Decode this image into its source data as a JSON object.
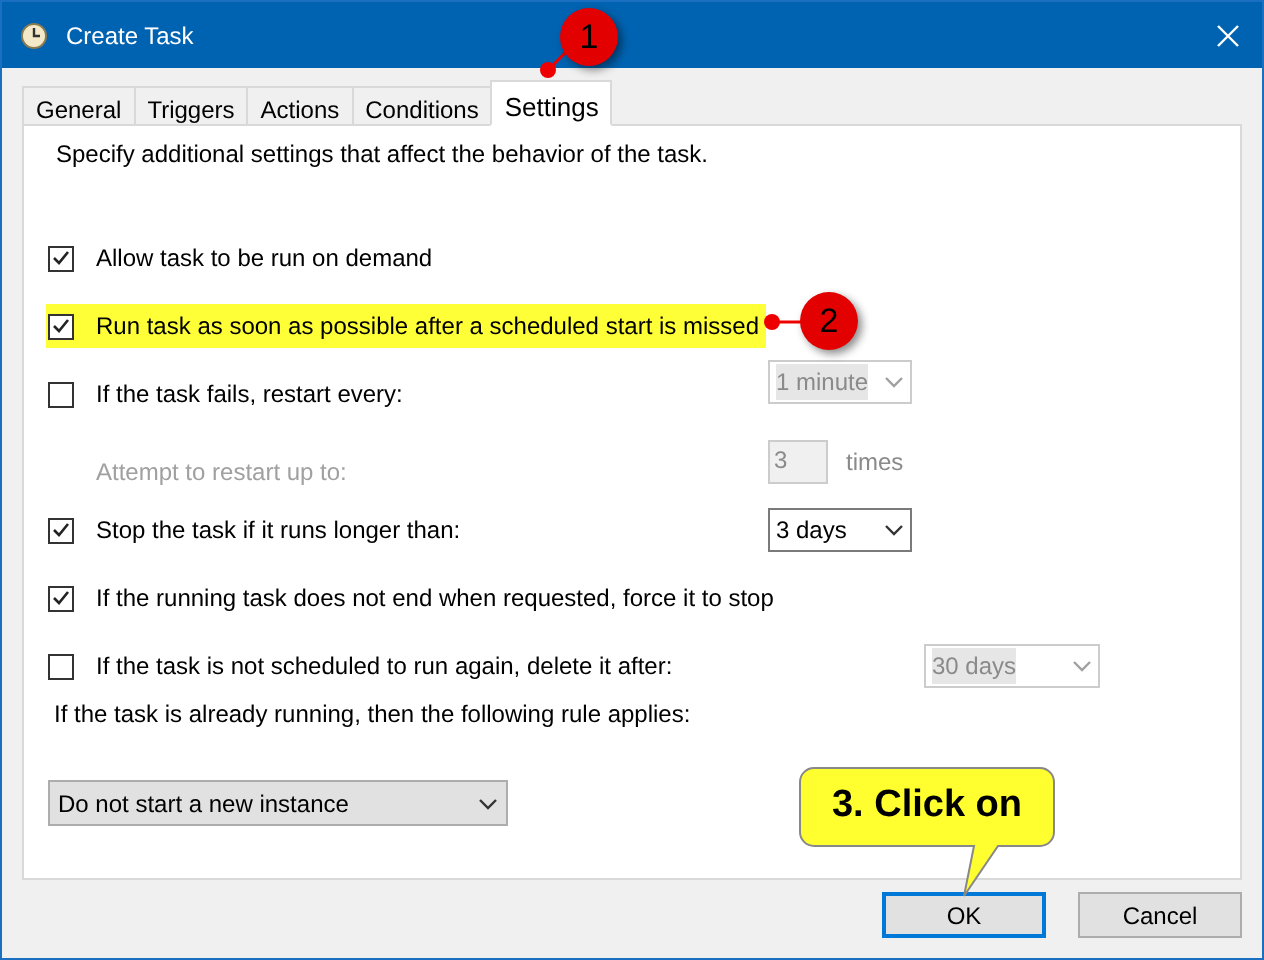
{
  "window": {
    "title": "Create Task"
  },
  "tabs": [
    {
      "label": "General",
      "selected": false
    },
    {
      "label": "Triggers",
      "selected": false
    },
    {
      "label": "Actions",
      "selected": false
    },
    {
      "label": "Conditions",
      "selected": false
    },
    {
      "label": "Settings",
      "selected": true
    }
  ],
  "description": "Specify additional settings that affect the behavior of the task.",
  "settings": [
    {
      "kind": "checkbox",
      "label": "Allow task to be run on demand",
      "checked": true,
      "highlighted": false
    },
    {
      "kind": "checkbox",
      "label": "Run task as soon as possible after a scheduled start is missed",
      "checked": true,
      "highlighted": true
    },
    {
      "kind": "checkbox",
      "label": "If the task fails, restart every:",
      "checked": false,
      "highlighted": false,
      "control": {
        "kind": "select",
        "value": "1 minute",
        "disabled": true
      }
    },
    {
      "kind": "label",
      "label": "Attempt to restart up to:",
      "disabled": true,
      "control": {
        "kind": "number",
        "value": "3",
        "unit": "times",
        "disabled": true
      }
    },
    {
      "kind": "checkbox",
      "label": "Stop the task if it runs longer than:",
      "checked": true,
      "highlighted": false,
      "control": {
        "kind": "select",
        "value": "3 days",
        "disabled": false
      }
    },
    {
      "kind": "checkbox",
      "label": "If the running task does not end when requested, force it to stop",
      "checked": true,
      "highlighted": false
    },
    {
      "kind": "checkbox",
      "label": "If the task is not scheduled to run again, delete it after:",
      "checked": false,
      "highlighted": false,
      "control": {
        "kind": "select",
        "value": "30 days",
        "disabled": true
      }
    }
  ],
  "rule": {
    "label": "If the task is already running, then the following rule applies:",
    "value": "Do not start a new instance"
  },
  "buttons": [
    {
      "label": "OK",
      "default": true
    },
    {
      "label": "Cancel",
      "default": false
    }
  ],
  "callouts": [
    {
      "kind": "badge",
      "text": "1"
    },
    {
      "kind": "badge",
      "text": "2"
    },
    {
      "kind": "note",
      "text": "3. Click on"
    }
  ]
}
